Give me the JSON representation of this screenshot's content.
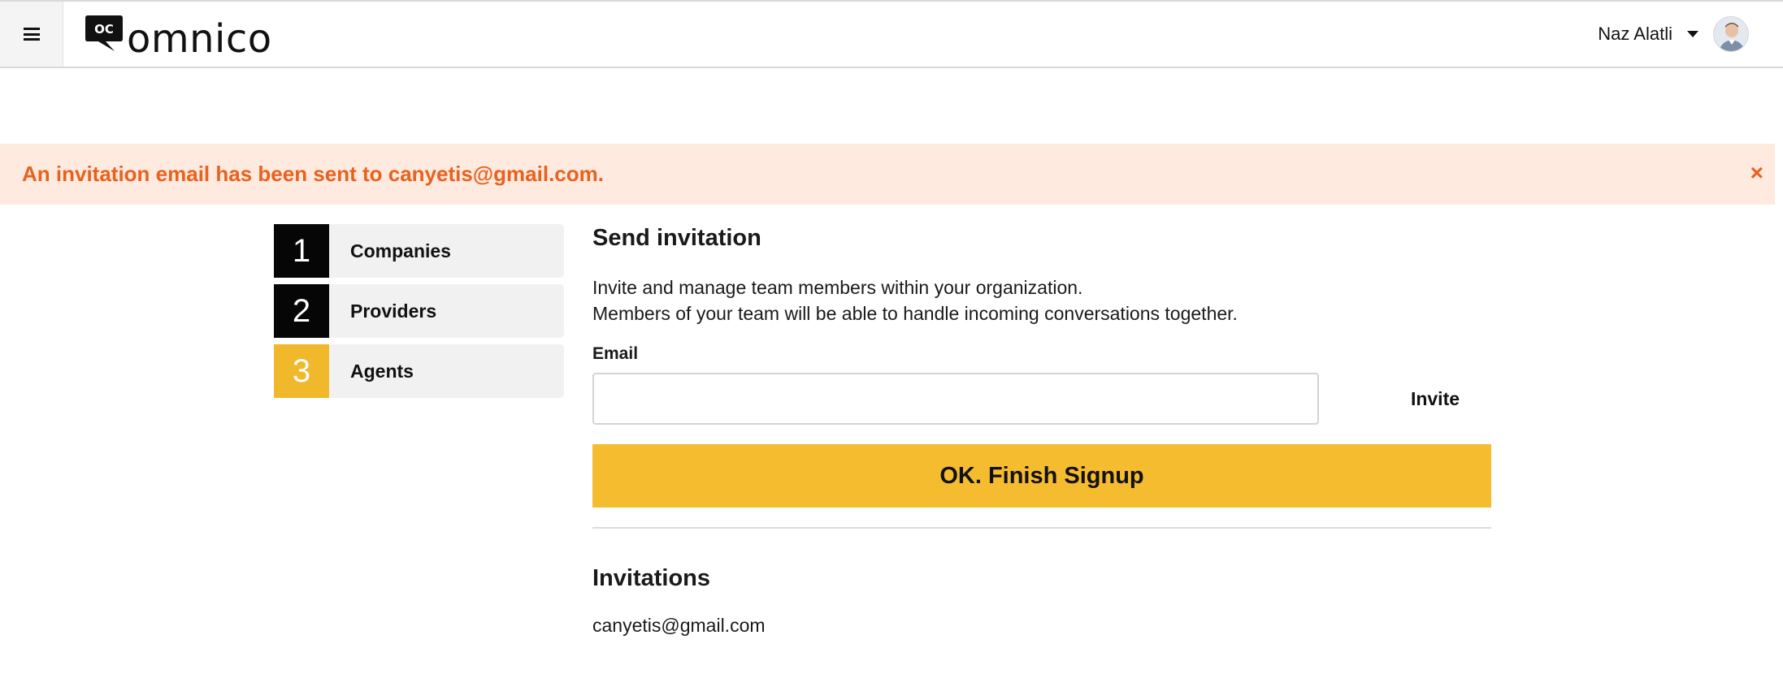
{
  "header": {
    "menu_icon": "hamburger-menu-icon",
    "logo_mark_text": "OC",
    "logo_text": "omnico",
    "user_name": "Naz Alatli",
    "caret_icon": "caret-down-icon",
    "avatar": "user-avatar"
  },
  "alert": {
    "message": "An invitation email has been sent to canyetis@gmail.com.",
    "close_symbol": "×",
    "color": "#e8621f",
    "background": "#ffeadf"
  },
  "steps": [
    {
      "number": "1",
      "label": "Companies",
      "state": "done"
    },
    {
      "number": "2",
      "label": "Providers",
      "state": "done"
    },
    {
      "number": "3",
      "label": "Agents",
      "state": "active"
    }
  ],
  "send_invitation": {
    "title": "Send invitation",
    "description_line1": "Invite and manage team members within your organization.",
    "description_line2": "Members of your team will be able to handle incoming conversations together.",
    "email_label": "Email",
    "email_value": "",
    "email_placeholder": "",
    "invite_label": "Invite",
    "finish_label": "OK. Finish Signup"
  },
  "invitations": {
    "title": "Invitations",
    "items": [
      "canyetis@gmail.com"
    ]
  },
  "colors": {
    "accent_yellow": "#f6bc2f",
    "step_active": "#f0b82a",
    "step_done": "#060606"
  }
}
